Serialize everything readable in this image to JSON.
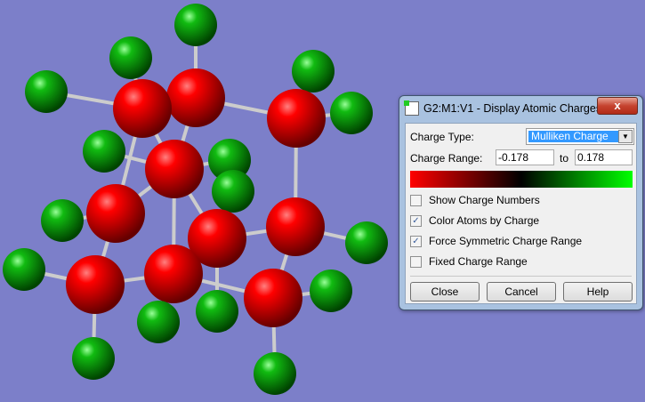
{
  "dialog": {
    "title": "G2:M1:V1 - Display Atomic Charges",
    "close_icon_label": "x",
    "charge_type_label": "Charge Type:",
    "charge_type_value": "Mulliken Charge",
    "charge_range_label": "Charge Range:",
    "range_min": "-0.178",
    "range_to": "to",
    "range_max": "0.178",
    "checkboxes": [
      {
        "label": "Show Charge Numbers",
        "checked": false
      },
      {
        "label": "Color Atoms by Charge",
        "checked": true
      },
      {
        "label": "Force Symmetric Charge Range",
        "checked": true
      },
      {
        "label": "Fixed Charge Range",
        "checked": false
      }
    ],
    "buttons": {
      "close": "Close",
      "cancel": "Cancel",
      "help": "Help"
    }
  },
  "colors": {
    "background": "#7c7fc9",
    "negative": "#ff0000",
    "positive": "#00ff00"
  }
}
